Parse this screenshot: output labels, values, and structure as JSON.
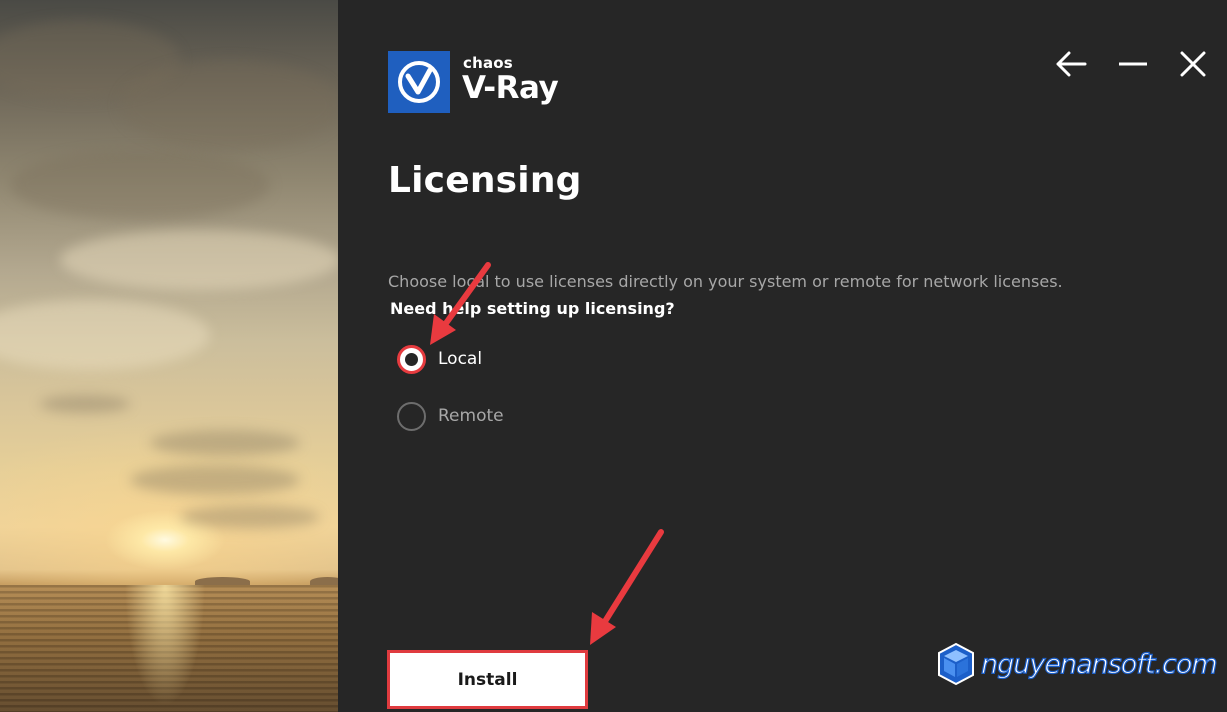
{
  "brand": {
    "company": "chaos",
    "product": "V-Ray",
    "accent": "#1f5fbf"
  },
  "window_controls": {
    "back_icon": "arrow-left-icon",
    "minimize_icon": "minimize-icon",
    "close_icon": "close-icon"
  },
  "page": {
    "title": "Licensing",
    "description": "Choose local to use licenses directly on your system or remote for network licenses.",
    "help_link": "Need help setting up licensing?"
  },
  "license_options": [
    {
      "label": "Local",
      "selected": true
    },
    {
      "label": "Remote",
      "selected": false
    }
  ],
  "install_button": {
    "label": "Install"
  },
  "watermark": {
    "text": "nguyenansoft.com",
    "icon": "cube-icon"
  },
  "colors": {
    "background": "#262626",
    "highlight": "#e63b3f",
    "muted_text": "#a7a7a7"
  }
}
